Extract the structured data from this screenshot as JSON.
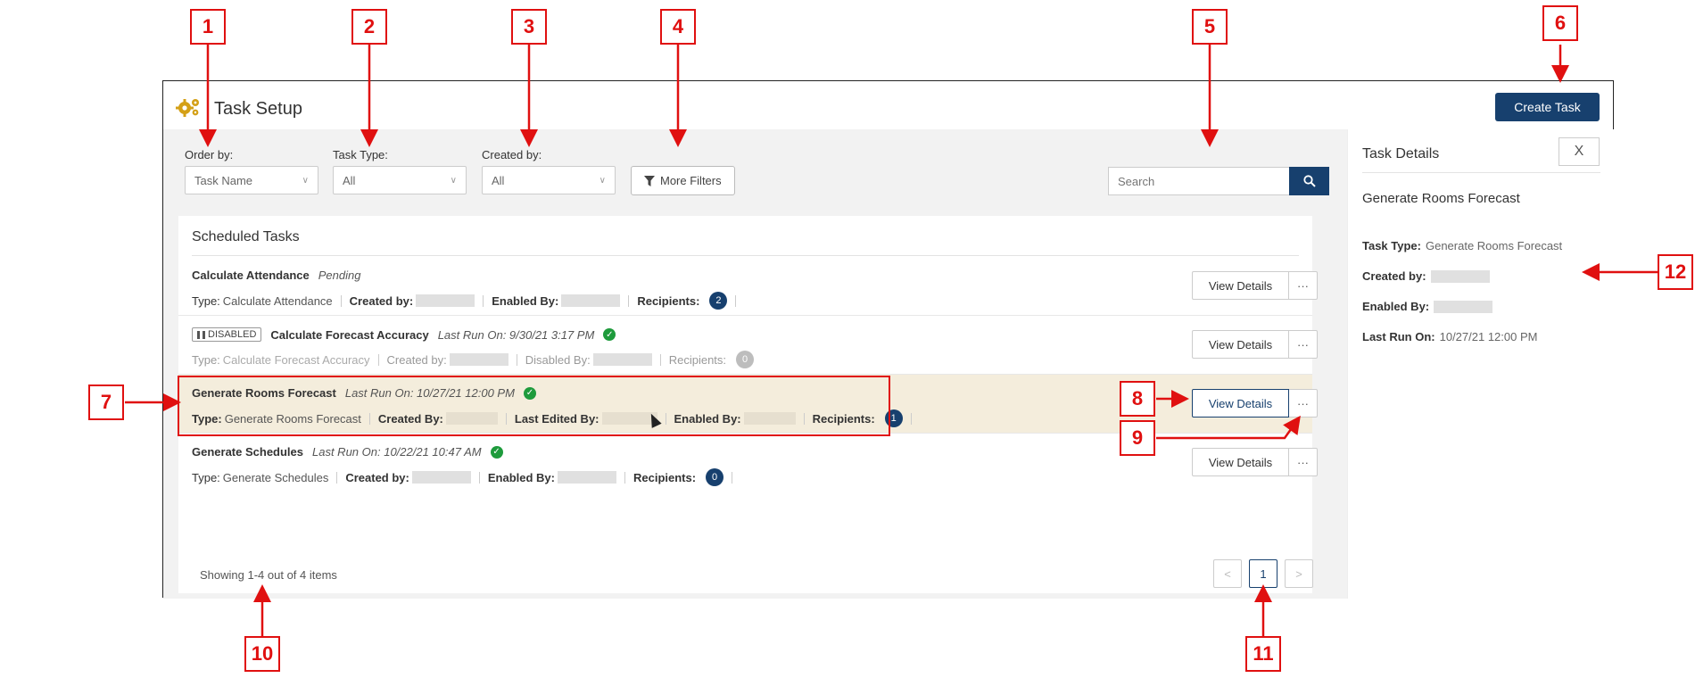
{
  "app": {
    "title": "Task Setup",
    "create_button": "Create Task"
  },
  "filters": {
    "order_by": {
      "label": "Order by:",
      "value": "Task Name"
    },
    "task_type": {
      "label": "Task Type:",
      "value": "All"
    },
    "created_by": {
      "label": "Created by:",
      "value": "All"
    },
    "more_filters": "More Filters",
    "search_placeholder": "Search"
  },
  "tasks": {
    "title": "Scheduled Tasks",
    "view_details_label": "View Details",
    "more_label": "···",
    "rows": [
      {
        "name": "Calculate Attendance",
        "status": "Pending",
        "type_label": "Type:",
        "type_value": "Calculate Attendance",
        "f2_label": "Created by:",
        "f3_label": "Enabled By:",
        "recipients_label": "Recipients:",
        "recipients": "2"
      },
      {
        "disabled_badge": "DISABLED",
        "name": "Calculate Forecast Accuracy",
        "status": "Last Run On: 9/30/21 3:17 PM",
        "type_label": "Type:",
        "type_value": "Calculate Forecast Accuracy",
        "f2_label": "Created by:",
        "f3_label": "Disabled By:",
        "recipients_label": "Recipients:",
        "recipients": "0"
      },
      {
        "name": "Generate Rooms Forecast",
        "status": "Last Run On: 10/27/21 12:00 PM",
        "type_label": "Type:",
        "type_value": "Generate Rooms Forecast",
        "f2_label": "Created By:",
        "f3_label": "Last Edited By:",
        "f4_label": "Enabled By:",
        "recipients_label": "Recipients:",
        "recipients": "1"
      },
      {
        "name": "Generate Schedules",
        "status": "Last Run On: 10/22/21 10:47 AM",
        "type_label": "Type:",
        "type_value": "Generate Schedules",
        "f2_label": "Created by:",
        "f3_label": "Enabled By:",
        "recipients_label": "Recipients:",
        "recipients": "0"
      }
    ],
    "showing": "Showing 1-4 out of 4 items",
    "pager": {
      "prev": "<",
      "page": "1",
      "next": ">"
    }
  },
  "details": {
    "title": "Task Details",
    "close": "X",
    "task_name": "Generate Rooms Forecast",
    "task_type_label": "Task Type:",
    "task_type_value": "Generate Rooms Forecast",
    "created_by_label": "Created by:",
    "enabled_by_label": "Enabled By:",
    "last_run_label": "Last Run On:",
    "last_run_value": "10/27/21 12:00 PM"
  },
  "annotations": [
    "1",
    "2",
    "3",
    "4",
    "5",
    "6",
    "7",
    "8",
    "9",
    "10",
    "11",
    "12"
  ],
  "colors": {
    "primary": "#17406e",
    "annotation": "#e01010",
    "selected_row": "#f4eddc",
    "success": "#1e9b3c",
    "icon_gold": "#d4a017"
  }
}
